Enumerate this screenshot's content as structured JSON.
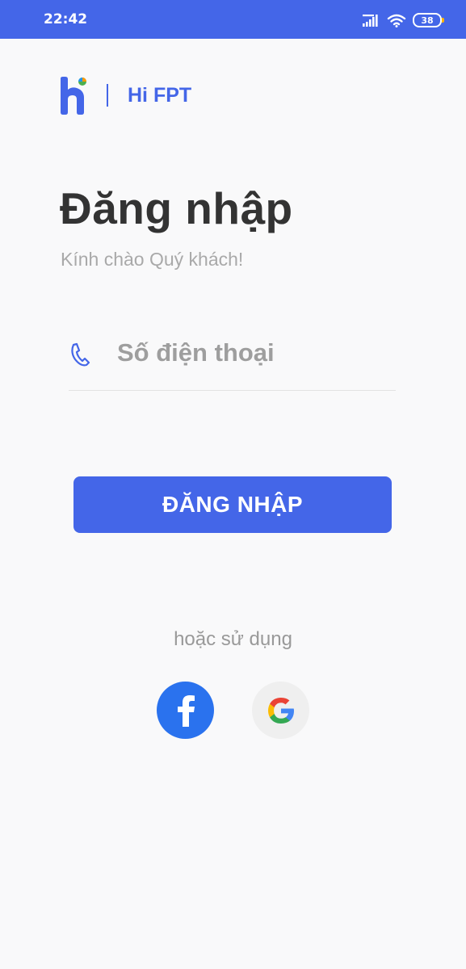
{
  "status_bar": {
    "time": "22:42",
    "battery_level": "38",
    "icons": [
      "signal-icon",
      "wifi-icon",
      "battery-icon"
    ]
  },
  "brand": {
    "name": "Hi FPT",
    "logo_icon": "hi-fpt-logo"
  },
  "login": {
    "title": "Đăng nhập",
    "subtitle": "Kính chào Quý khách!",
    "phone_placeholder": "Số điện thoại",
    "phone_value": "",
    "submit_label": "ĐĂNG NHẬP",
    "alt_label": "hoặc sử dụng"
  },
  "social": {
    "facebook_icon": "facebook-icon",
    "google_icon": "google-icon"
  },
  "colors": {
    "primary": "#4466e8",
    "facebook": "#2a72ee",
    "title_text": "#333333",
    "muted_text": "#a9a9a9"
  }
}
